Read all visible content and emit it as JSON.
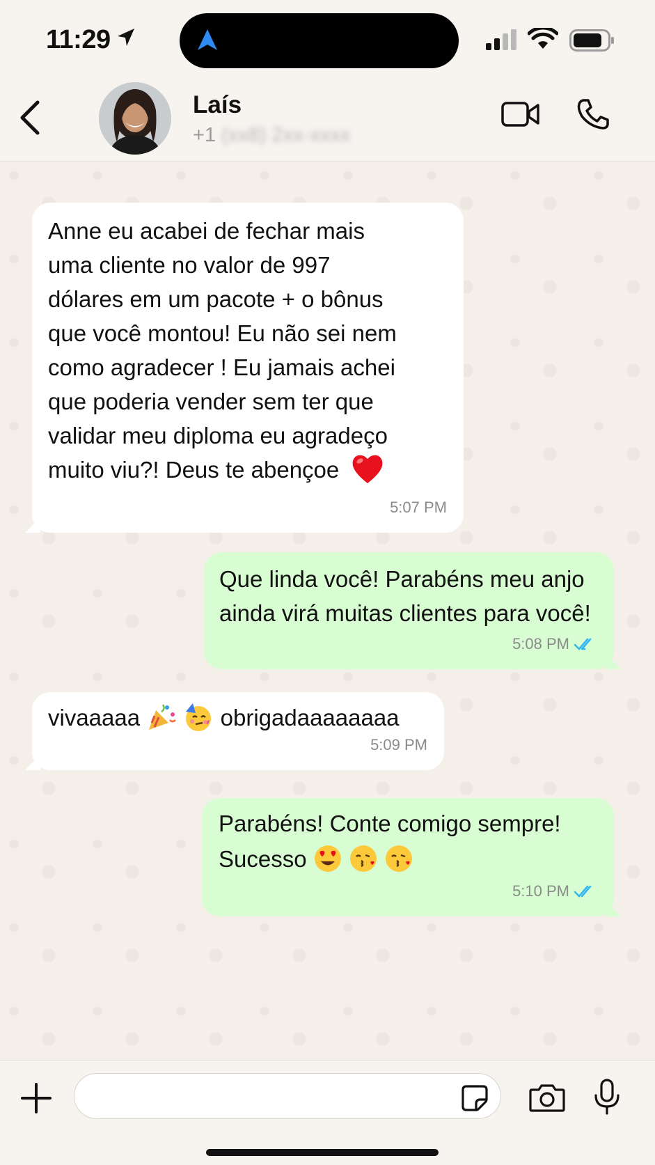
{
  "status_bar": {
    "time": "11:29"
  },
  "header": {
    "contact_name": "Laís",
    "contact_number_prefix": "+1",
    "contact_number_redacted": "(xx8) 2xx-xxxx"
  },
  "messages": [
    {
      "direction": "incoming",
      "text": "Anne eu acabei de fechar mais\numa cliente no valor de 997\ndólares em um pacote + o bônus\nque você montou! Eu não sei nem\ncomo agradecer ! Eu jamais achei\nque poderia vender sem ter que\nvalidar meu diploma eu agradeço\nmuito viu?! Deus te abençoe",
      "emoji": "heart",
      "time": "5:07 PM"
    },
    {
      "direction": "outgoing",
      "text": "Que linda você! Parabéns meu anjo\nainda virá muitas clientes para você!",
      "time": "5:08 PM",
      "read": true
    },
    {
      "direction": "incoming",
      "text_before": "vivaaaaa",
      "emojis": [
        "party-popper",
        "partying-face"
      ],
      "text_after": "obrigadaaaaaaaa",
      "time": "5:09 PM"
    },
    {
      "direction": "outgoing",
      "line1": "Parabéns! Conte comigo sempre!",
      "line2": "Sucesso",
      "emojis": [
        "heart-eyes",
        "kissing-heart",
        "kissing-heart"
      ],
      "time": "5:10 PM",
      "read": true
    }
  ],
  "composer": {
    "placeholder": ""
  },
  "colors": {
    "incoming_bubble": "#ffffff",
    "outgoing_bubble": "#d9fdd3",
    "read_ticks": "#34b7f1",
    "accent_blue": "#2f8af5"
  }
}
